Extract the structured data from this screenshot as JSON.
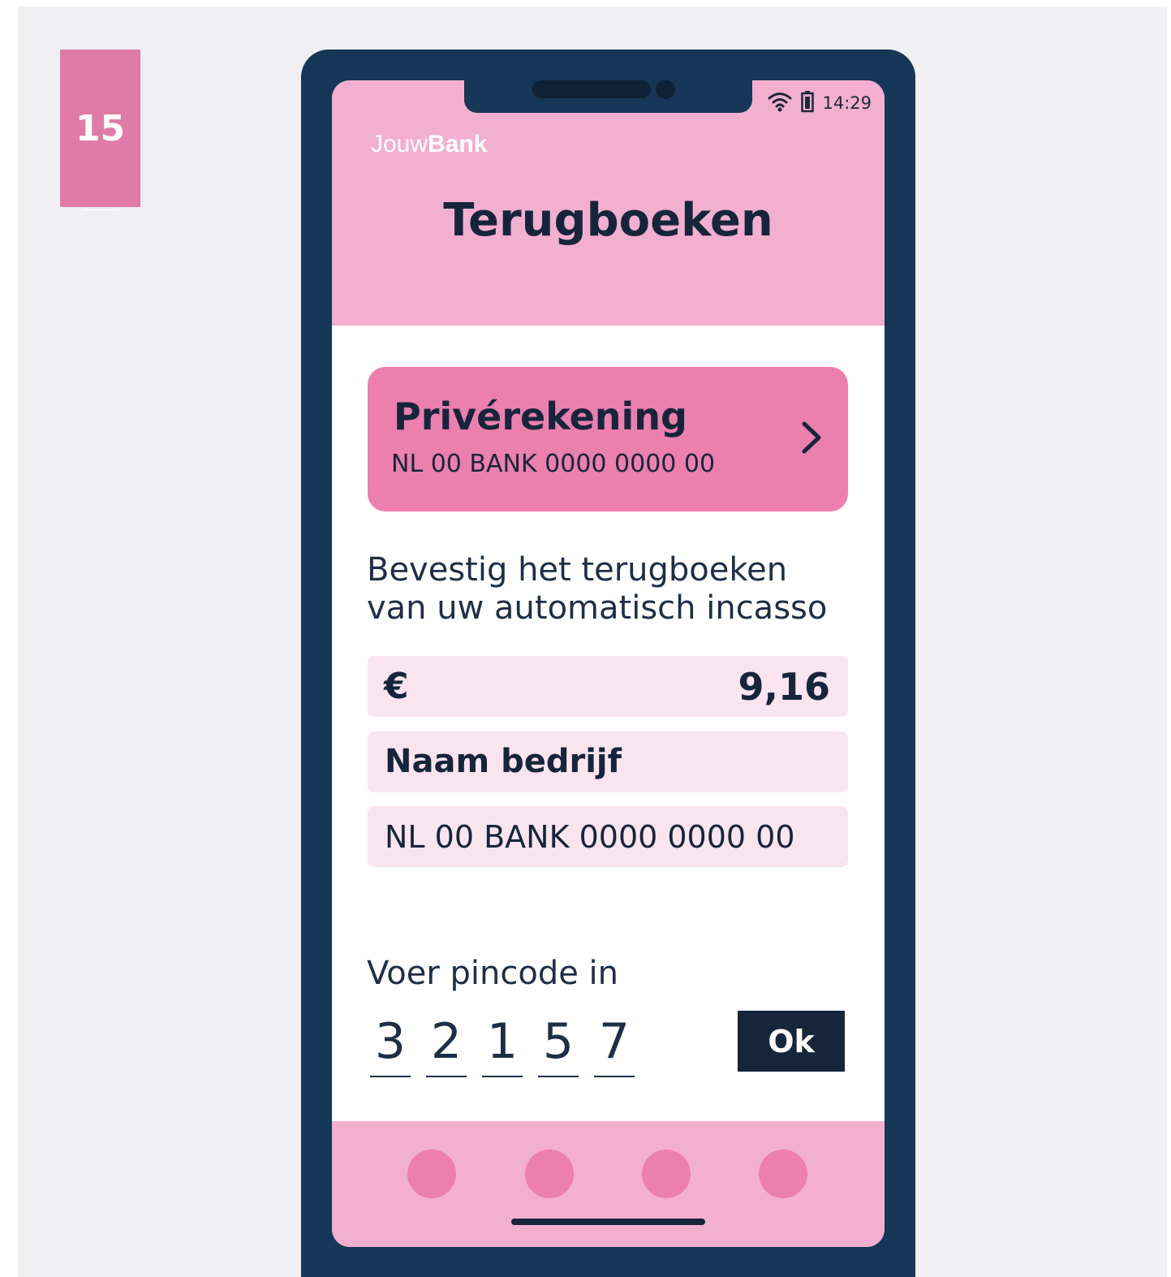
{
  "step": {
    "number": "15"
  },
  "status_bar": {
    "time": "14:29",
    "wifi_icon": "wifi-icon",
    "battery_icon": "battery-icon"
  },
  "brand": {
    "light": "Jouw",
    "bold": "Bank"
  },
  "page": {
    "title": "Terugboeken"
  },
  "account": {
    "name": "Privérekening",
    "iban": "NL 00 BANK 0000 0000 00",
    "chevron_icon": "chevron-right-icon"
  },
  "confirm": {
    "text": "Bevestig het terugboeken van uw automatisch incasso"
  },
  "transaction": {
    "currency": "€",
    "amount": "9,16",
    "company": "Naam bedrijf",
    "counter_iban": "NL 00 BANK 0000 0000 00"
  },
  "pin": {
    "label": "Voer pincode in",
    "digits": [
      "3",
      "2",
      "1",
      "5",
      "7"
    ],
    "ok_label": "Ok"
  },
  "colors": {
    "page_background": "#f0f0f3",
    "step_badge": "#e07ba5",
    "phone_frame": "#163757",
    "header_pink": "#f3afd0",
    "card_pink": "#ec7fae",
    "field_pink": "#fae4f0",
    "text_dark": "#16263a"
  },
  "bottom_nav": {
    "item_count": 4
  }
}
